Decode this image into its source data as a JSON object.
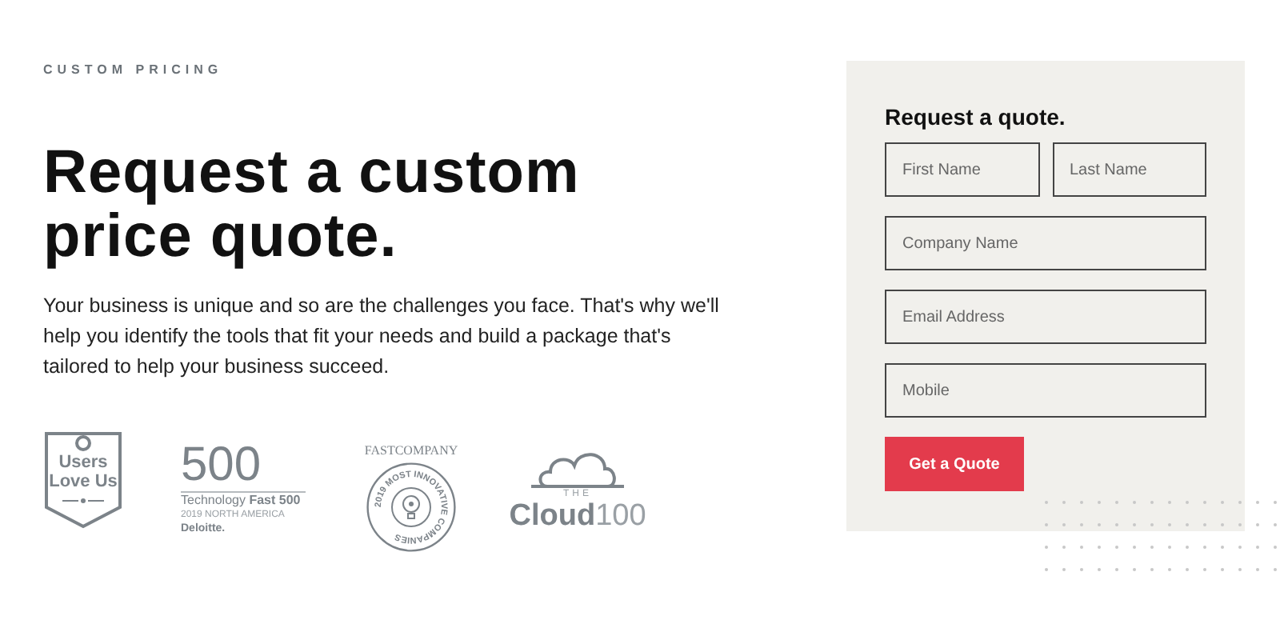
{
  "eyebrow": "CUSTOM PRICING",
  "heading": [
    "Request a custom",
    "price quote."
  ],
  "intro": "Your business is unique and so are the challenges you face. That's why we'll help you identify the tools that fit your needs and build a package that's tailored to help your business succeed.",
  "badges": [
    {
      "kind": "g2",
      "lines": [
        "Users",
        "Love Us"
      ]
    },
    {
      "kind": "deloitte",
      "big": "500",
      "line1": "Technology **Fast 500**",
      "line2": "2019 NORTH AMERICA",
      "brand": "Deloitte."
    },
    {
      "kind": "fastcompany",
      "brand": "FASTCOMPANY",
      "ring": "2019 MOST INNOVATIVE COMPANIES"
    },
    {
      "kind": "cloud",
      "small": "THE",
      "word": "Cloud",
      "number": "100"
    }
  ],
  "form": {
    "title": "Request a quote.",
    "rows": [
      [
        {
          "placeholder": "First Name"
        },
        {
          "placeholder": "Last Name"
        }
      ],
      [
        {
          "placeholder": "Company Name"
        }
      ],
      [
        {
          "placeholder": "Email Address"
        }
      ],
      [
        {
          "placeholder": "Mobile"
        }
      ]
    ],
    "submit": "Get a Quote"
  }
}
